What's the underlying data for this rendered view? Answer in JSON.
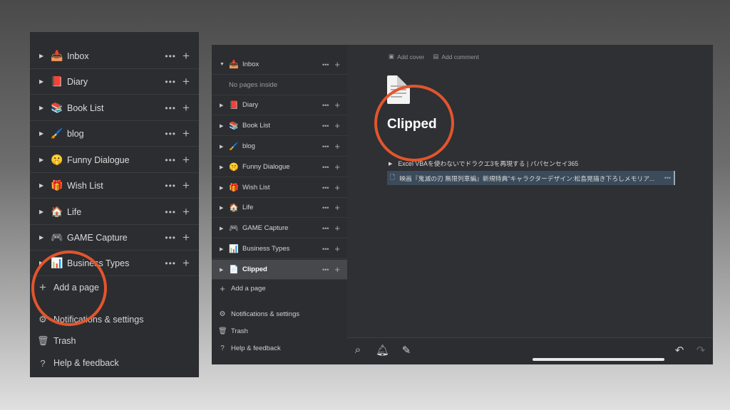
{
  "left_panel": {
    "items": [
      {
        "emoji": "📥",
        "label": "Inbox"
      },
      {
        "emoji": "📕",
        "label": "Diary"
      },
      {
        "emoji": "📚",
        "label": "Book List"
      },
      {
        "emoji": "🖌️",
        "label": "blog"
      },
      {
        "emoji": "🤫",
        "label": "Funny Dialogue"
      },
      {
        "emoji": "🎁",
        "label": "Wish List"
      },
      {
        "emoji": "🏠",
        "label": "Life"
      },
      {
        "emoji": "🎮",
        "label": "GAME Capture"
      },
      {
        "emoji": "📊",
        "label": "Business Types"
      }
    ],
    "add_page": "Add a page",
    "notifications": "Notifications & settings",
    "trash": "Trash",
    "help": "Help & feedback",
    "more": "•••",
    "plus": "+"
  },
  "right_panel": {
    "sidebar": {
      "items": [
        {
          "emoji": "📥",
          "label": "Inbox"
        },
        {
          "emoji": "",
          "label": "No pages inside"
        },
        {
          "emoji": "📕",
          "label": "Diary"
        },
        {
          "emoji": "📚",
          "label": "Book List"
        },
        {
          "emoji": "🖌️",
          "label": "blog"
        },
        {
          "emoji": "🤫",
          "label": "Funny Dialogue"
        },
        {
          "emoji": "🎁",
          "label": "Wish List"
        },
        {
          "emoji": "🏠",
          "label": "Life"
        },
        {
          "emoji": "🎮",
          "label": "GAME Capture"
        },
        {
          "emoji": "📊",
          "label": "Business Types"
        },
        {
          "emoji": "📄",
          "label": "Clipped"
        }
      ],
      "add_page": "Add a page",
      "notifications": "Notifications & settings",
      "trash": "Trash",
      "help": "Help & feedback"
    },
    "main": {
      "add_cover": "Add cover",
      "add_comment": "Add comment",
      "title": "Clipped",
      "entries": [
        "Excel VBAを使わないでドラクエ3を再現する | パパセンセイ365",
        "映画『鬼滅の刃 無限列車編』新規特典\"キャラクターデザイン:松島晃描き下ろしメモリア..."
      ]
    }
  },
  "colors": {
    "accent_circle": "#e2552d"
  }
}
